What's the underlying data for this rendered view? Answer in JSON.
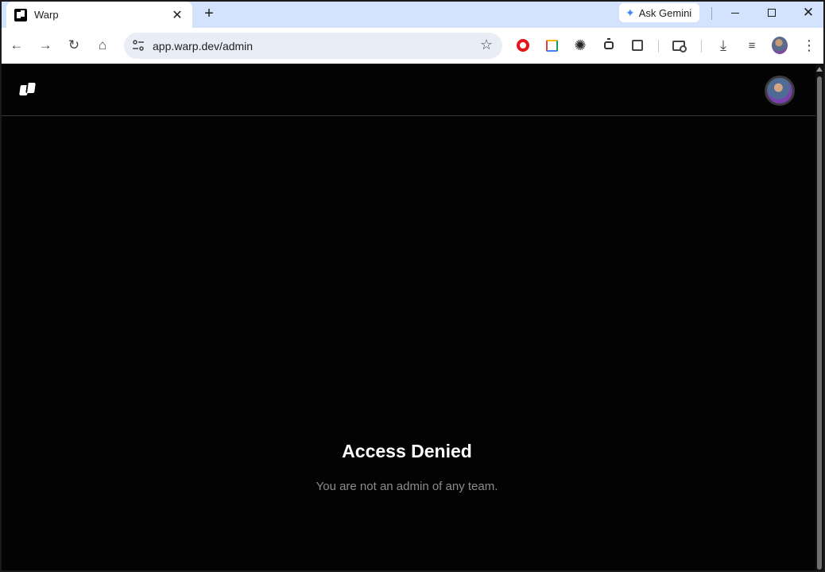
{
  "browser": {
    "tab": {
      "title": "Warp",
      "close_glyph": "✕",
      "favicon": "warp-icon"
    },
    "new_tab_glyph": "+",
    "gemini": {
      "label": "Ask Gemini",
      "icon": "gemini-sparkle-icon"
    },
    "window_close_glyph": "✕",
    "url": "app.warp.dev/admin",
    "nav": {
      "back": "←",
      "forward": "→",
      "reload": "↻",
      "home": "⌂"
    },
    "star_glyph": "☆",
    "extensions": [
      "opera-icon",
      "palette-icon",
      "sun-icon",
      "robot-icon",
      "puzzle-icon"
    ],
    "download_glyph": "⤓",
    "media_glyph": "≡",
    "kebab_glyph": "⋮"
  },
  "page": {
    "title": "Access Denied",
    "message": "You are not an admin of any team."
  },
  "colors": {
    "tab_strip": "#d3e3fd",
    "page_background": "#030303",
    "title_text": "#ffffff",
    "message_text": "#8c8c8c"
  }
}
